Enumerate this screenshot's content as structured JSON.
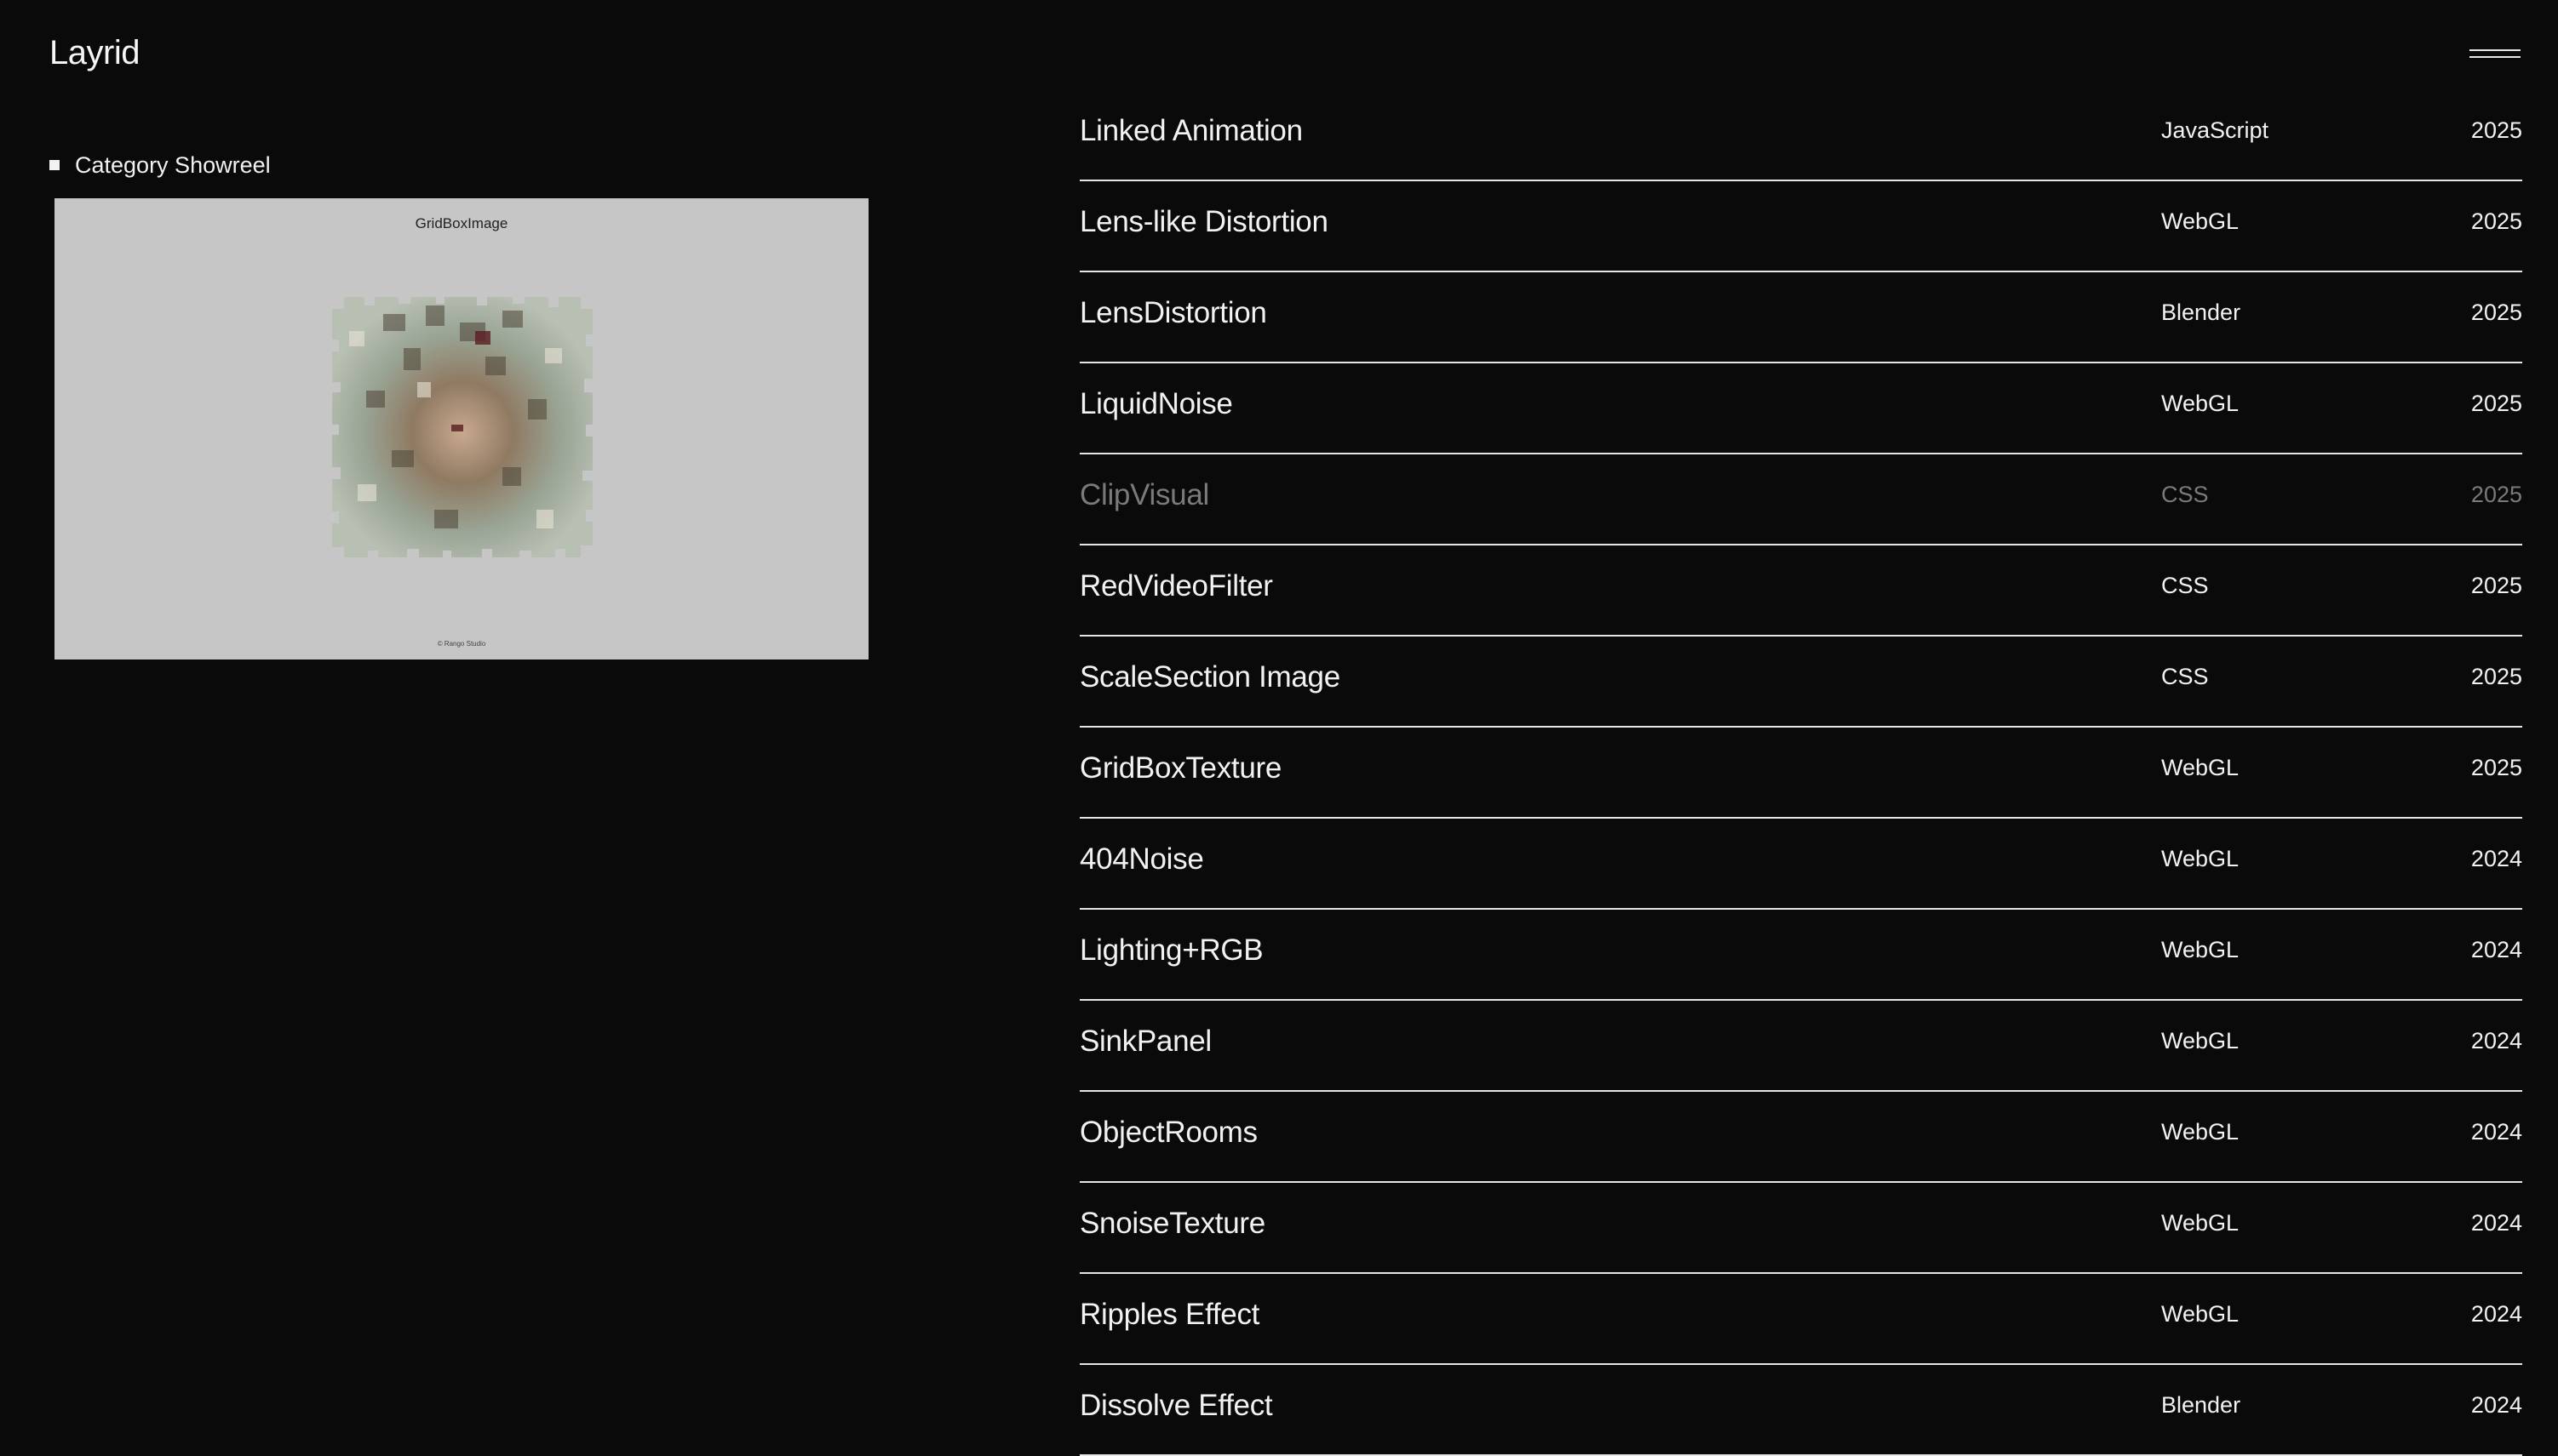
{
  "header": {
    "logo": "Layrid",
    "menu_icon": "hamburger-menu-icon"
  },
  "category": {
    "marker_icon": "square-bullet-icon",
    "label": "Category Showreel"
  },
  "preview": {
    "title": "GridBoxImage",
    "footer": "© Rango Studio",
    "image": "woman with flowers in hair fragmented into grid tiles"
  },
  "projects": [
    {
      "name": "Linked Animation",
      "tech": "JavaScript",
      "year": "2025"
    },
    {
      "name": "Lens-like Distortion",
      "tech": "WebGL",
      "year": "2025"
    },
    {
      "name": "LensDistortion",
      "tech": "Blender",
      "year": "2025"
    },
    {
      "name": "LiquidNoise",
      "tech": "WebGL",
      "year": "2025"
    },
    {
      "name": "ClipVisual",
      "tech": "CSS",
      "year": "2025"
    },
    {
      "name": "RedVideoFilter",
      "tech": "CSS",
      "year": "2025"
    },
    {
      "name": "ScaleSection Image",
      "tech": "CSS",
      "year": "2025"
    },
    {
      "name": "GridBoxTexture",
      "tech": "WebGL",
      "year": "2025"
    },
    {
      "name": "404Noise",
      "tech": "WebGL",
      "year": "2024"
    },
    {
      "name": "Lighting+RGB",
      "tech": "WebGL",
      "year": "2024"
    },
    {
      "name": "SinkPanel",
      "tech": "WebGL",
      "year": "2024"
    },
    {
      "name": "ObjectRooms",
      "tech": "WebGL",
      "year": "2024"
    },
    {
      "name": "SnoiseTexture",
      "tech": "WebGL",
      "year": "2024"
    },
    {
      "name": "Ripples Effect",
      "tech": "WebGL",
      "year": "2024"
    },
    {
      "name": "Dissolve Effect",
      "tech": "Blender",
      "year": "2024"
    }
  ],
  "colors": {
    "background": "#0a0a0a",
    "text": "#f2f2f2",
    "dim_text": "#7a7a7a",
    "preview_bg": "#c6c6c6",
    "divider": "#e6e6e6"
  }
}
